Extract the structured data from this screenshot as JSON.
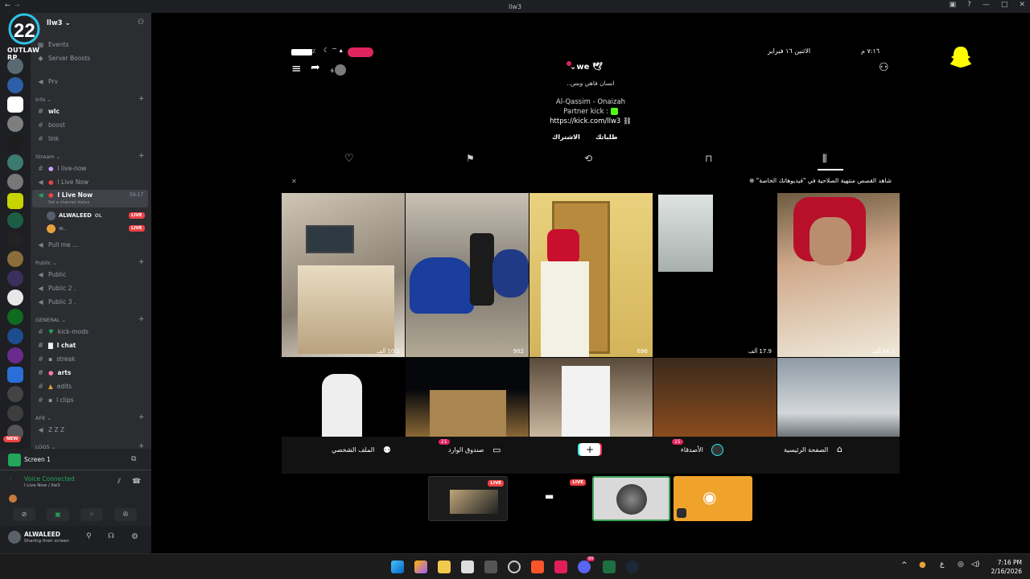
{
  "window": {
    "title": "llw3"
  },
  "logo": {
    "text": "OUTLAW RP"
  },
  "sidebar": {
    "server_name": "llw3",
    "top_items": [
      {
        "label": "Events"
      },
      {
        "label": "Server Boosts"
      },
      {
        "label": "Prv"
      }
    ],
    "categories": {
      "info": "Info",
      "stream": "Stream",
      "public": "Public",
      "general": "GENERAL",
      "afk": "AFK",
      "logs": "LOGS"
    },
    "channels": {
      "wlc": "wlc",
      "boost": "boost",
      "link": "link",
      "live_now_1": "l live-now",
      "live_now_2": "l Live Now",
      "live_now_3": "l Live Now",
      "live_now_timer": "59:17",
      "set_status": "Set a channel status",
      "pull_me": "Pull me ...",
      "public_1": "Public",
      "public_2": "Public 2 .",
      "public_3": "Public 3 .",
      "kick_mods": "kick-mods",
      "chat": "l chat",
      "streak": "streak",
      "arts": "arts",
      "edits": "edits",
      "clips": "l clips",
      "zzz": "Z Z Z"
    },
    "voice_users": [
      {
        "name": "ALWALEED",
        "tag": "OL",
        "badge": "LIVE"
      },
      {
        "name": "w..",
        "badge": "LIVE"
      }
    ],
    "badge_new": "NEW"
  },
  "user_panel": {
    "screen_label": "Screen 1",
    "voice_status": "Voice Connected",
    "voice_channel": "l Live Now / llw3",
    "username": "ALWALEED",
    "user_status": "Sharing their screen"
  },
  "snapchat": {
    "status_time": "٧:١٦ م",
    "status_date": "الاثنين ١٦ فبراير",
    "battery": "٨٣٪",
    "display_name": "we",
    "bio_1": "انسان فاهي وبس..",
    "bio_2": "Al-Qassim - Onaizah",
    "bio_3": "Partner kick :",
    "link": "https://kick.com/llw3",
    "action_orders": "طلباتك",
    "action_subscribe": "الاشتراك",
    "share_count": "6",
    "notice": "شاهد القصص منتهية الصلاحية في \"فيديوهاتك الخاصة\"",
    "tile_counts": [
      "10.1 ألف",
      "902",
      "696",
      "17.9 ألف",
      "34.1 ألف"
    ],
    "nav": {
      "home": "الصفحة الرئيسية",
      "friends": "الأصدقاء",
      "friends_badge": "15",
      "inbox": "صندوق الوارد",
      "inbox_badge": "21",
      "profile": "الملف الشخصي"
    }
  },
  "stream_thumbs": {
    "live_1": "LIVE",
    "live_2": "LIVE"
  },
  "taskbar": {
    "time": "7:16 PM",
    "date": "2/16/2026",
    "lang": "ع",
    "discord_badge": "99"
  },
  "colors": {
    "discord_bg": "#2b2d31",
    "live_red": "#ed4245",
    "snap_yellow": "#fffc00",
    "accent_pink": "#e0245e"
  }
}
